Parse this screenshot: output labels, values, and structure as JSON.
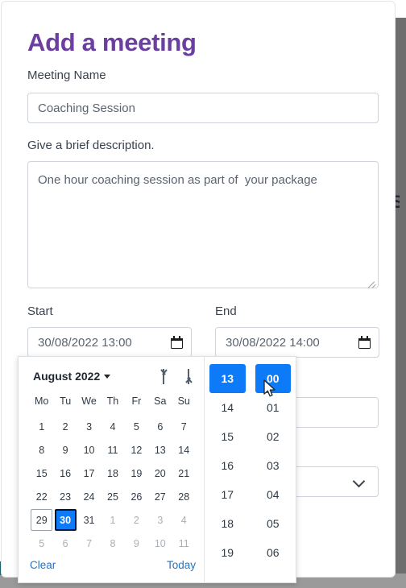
{
  "theme": {
    "title_purple": "#6b3fa0",
    "accent_blue": "#0d7bf7",
    "link_blue": "#2573c7",
    "border_gray": "#ced4da",
    "bg_teal": "#1a6170"
  },
  "form": {
    "title": "Add a meeting",
    "meeting_name": {
      "label": "Meeting Name",
      "value": "Coaching Session",
      "placeholder": "Meeting Name"
    },
    "description": {
      "label": "Give a brief description.",
      "value": "One hour coaching session as part of  your package",
      "placeholder": "Give a brief description."
    },
    "start": {
      "label": "Start",
      "value": "30/08/2022 13:00",
      "icon": "calendar-icon"
    },
    "end": {
      "label": "End",
      "value": "30/08/2022 14:00",
      "icon": "calendar-icon"
    },
    "hidden_input": {
      "value": "",
      "placeholder": ""
    },
    "hidden_select": {
      "value": "",
      "icon": "chevron-down-icon"
    }
  },
  "picker": {
    "month_label": "August 2022",
    "month_caret_icon": "caret-down-icon",
    "prev_icon": "arrow-up-icon",
    "next_icon": "arrow-down-icon",
    "weekdays": [
      "Mo",
      "Tu",
      "We",
      "Th",
      "Fr",
      "Sa",
      "Su"
    ],
    "weeks": [
      [
        {
          "d": "1",
          "state": "normal"
        },
        {
          "d": "2",
          "state": "normal"
        },
        {
          "d": "3",
          "state": "normal"
        },
        {
          "d": "4",
          "state": "normal"
        },
        {
          "d": "5",
          "state": "normal"
        },
        {
          "d": "6",
          "state": "normal"
        },
        {
          "d": "7",
          "state": "normal"
        }
      ],
      [
        {
          "d": "8",
          "state": "normal"
        },
        {
          "d": "9",
          "state": "normal"
        },
        {
          "d": "10",
          "state": "normal"
        },
        {
          "d": "11",
          "state": "normal"
        },
        {
          "d": "12",
          "state": "normal"
        },
        {
          "d": "13",
          "state": "normal"
        },
        {
          "d": "14",
          "state": "normal"
        }
      ],
      [
        {
          "d": "15",
          "state": "normal"
        },
        {
          "d": "16",
          "state": "normal"
        },
        {
          "d": "17",
          "state": "normal"
        },
        {
          "d": "18",
          "state": "normal"
        },
        {
          "d": "19",
          "state": "normal"
        },
        {
          "d": "20",
          "state": "normal"
        },
        {
          "d": "21",
          "state": "normal"
        }
      ],
      [
        {
          "d": "22",
          "state": "normal"
        },
        {
          "d": "23",
          "state": "normal"
        },
        {
          "d": "24",
          "state": "normal"
        },
        {
          "d": "25",
          "state": "normal"
        },
        {
          "d": "26",
          "state": "normal"
        },
        {
          "d": "27",
          "state": "normal"
        },
        {
          "d": "28",
          "state": "normal"
        }
      ],
      [
        {
          "d": "29",
          "state": "today"
        },
        {
          "d": "30",
          "state": "selected"
        },
        {
          "d": "31",
          "state": "normal"
        },
        {
          "d": "1",
          "state": "muted"
        },
        {
          "d": "2",
          "state": "muted"
        },
        {
          "d": "3",
          "state": "muted"
        },
        {
          "d": "4",
          "state": "muted"
        }
      ],
      [
        {
          "d": "5",
          "state": "muted"
        },
        {
          "d": "6",
          "state": "muted"
        },
        {
          "d": "7",
          "state": "muted"
        },
        {
          "d": "8",
          "state": "muted"
        },
        {
          "d": "9",
          "state": "muted"
        },
        {
          "d": "10",
          "state": "muted"
        },
        {
          "d": "11",
          "state": "muted"
        }
      ]
    ],
    "clear_label": "Clear",
    "today_label": "Today",
    "hours": [
      {
        "v": "13",
        "state": "selected"
      },
      {
        "v": "14",
        "state": "normal"
      },
      {
        "v": "15",
        "state": "normal"
      },
      {
        "v": "16",
        "state": "normal"
      },
      {
        "v": "17",
        "state": "normal"
      },
      {
        "v": "18",
        "state": "normal"
      },
      {
        "v": "19",
        "state": "normal"
      }
    ],
    "minutes": [
      {
        "v": "00",
        "state": "selected"
      },
      {
        "v": "01",
        "state": "normal"
      },
      {
        "v": "02",
        "state": "normal"
      },
      {
        "v": "03",
        "state": "normal"
      },
      {
        "v": "04",
        "state": "normal"
      },
      {
        "v": "05",
        "state": "normal"
      },
      {
        "v": "06",
        "state": "normal"
      }
    ]
  },
  "background": {
    "ghost_letter": "S"
  }
}
